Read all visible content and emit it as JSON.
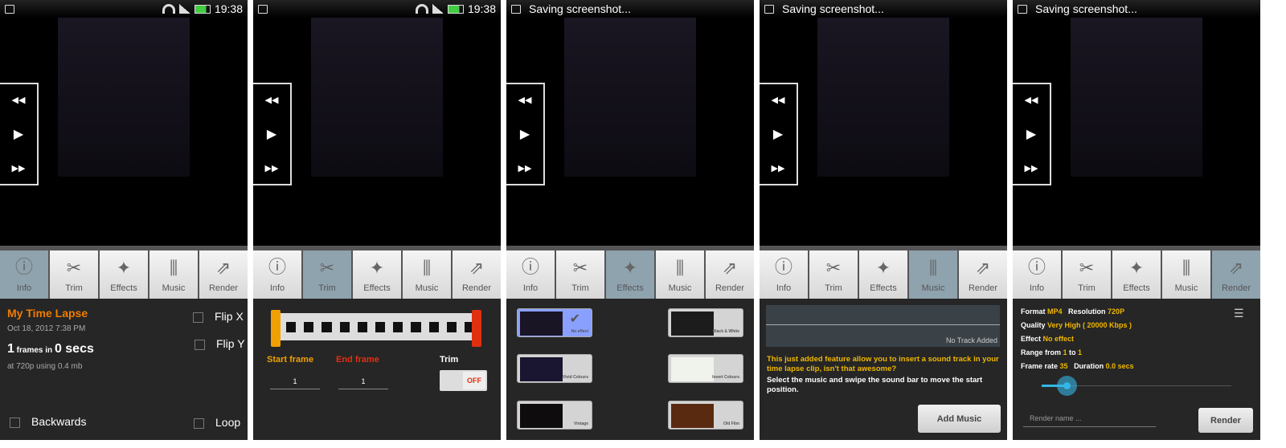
{
  "tabs": [
    {
      "label": "Info",
      "icon": "info-icon",
      "glyph": "ⓘ"
    },
    {
      "label": "Trim",
      "icon": "scissors-icon",
      "glyph": "✂"
    },
    {
      "label": "Effects",
      "icon": "effects-icon",
      "glyph": "✦"
    },
    {
      "label": "Music",
      "icon": "music-icon",
      "glyph": "⫼"
    },
    {
      "label": "Render",
      "icon": "render-icon",
      "glyph": "⇗"
    }
  ],
  "status": {
    "time": "19:38",
    "saving": "Saving screenshot..."
  },
  "player": {
    "rewind": "◀◀",
    "play": "▶",
    "forward": "▶▶"
  },
  "info": {
    "title": "My Time Lapse",
    "date": "Oct 18, 2012 7:38 PM",
    "frames": "1",
    "frames_label": " frames in ",
    "secs": "0 secs",
    "detail": "at 720p using 0.4 mb",
    "flip_x": "Flip X",
    "flip_y": "Flip Y",
    "backwards": "Backwards",
    "loop": "Loop"
  },
  "trim": {
    "start_label": "Start frame",
    "end_label": "End frame",
    "trim_label": "Trim",
    "start_value": "1",
    "end_value": "1",
    "toggle": "OFF"
  },
  "effects": [
    {
      "label": "No effect",
      "thumb": "#1a1525",
      "selected": true
    },
    {
      "label": "Black & White",
      "thumb": "#1c1c1c"
    },
    {
      "label": "Vivid Colours",
      "thumb": "#1a1530"
    },
    {
      "label": "Invert Colours",
      "thumb": "#f0f2ec"
    },
    {
      "label": "Vintage",
      "thumb": "#0e0c0c"
    },
    {
      "label": "Old Film",
      "thumb": "#5a2a10"
    }
  ],
  "music": {
    "track": "No Track Added",
    "desc1": "This just added feature allow you to insert a sound track in your time lapse clip, isn't that awesome?",
    "desc2": "Select the music and swipe the sound bar to move the start position.",
    "button": "Add Music"
  },
  "render": {
    "format_label": "Format ",
    "format": "MP4",
    "res_label": "Resolution ",
    "res": "720P",
    "quality_label": "Quality ",
    "quality": "Very High ( 20000 Kbps )",
    "effect_label": "Effect ",
    "effect": "No effect",
    "range_label": "Range from ",
    "range_from": "1",
    "to_label": " to ",
    "range_to": "1",
    "fps_label": "Frame rate ",
    "fps": "35",
    "dur_label": "Duration ",
    "dur": "0.0 secs",
    "slider_fraction": 0.13,
    "name_placeholder": "Render name ...",
    "button": "Render"
  }
}
